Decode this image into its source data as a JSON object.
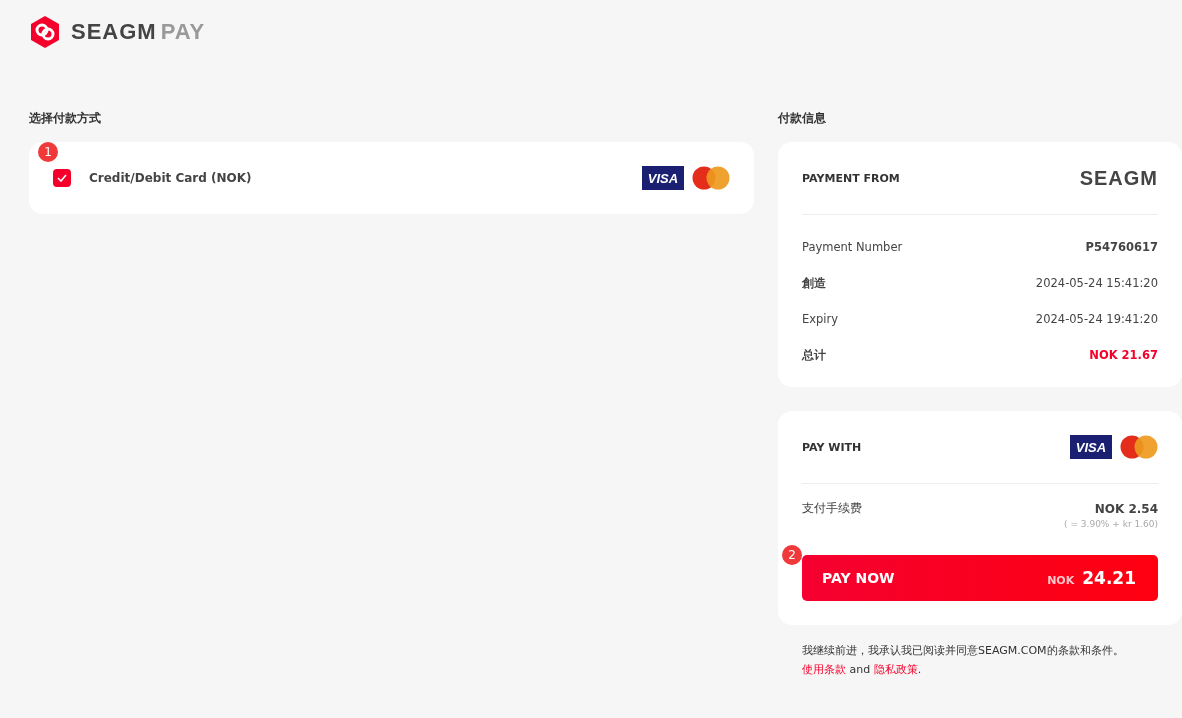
{
  "logo": {
    "brand": "SEAGM",
    "product": "PAY"
  },
  "methods": {
    "title": "选择付款方式",
    "items": [
      {
        "step": "1",
        "label": "Credit/Debit Card (NOK)",
        "checked": true,
        "card_mark": "VISA"
      }
    ]
  },
  "info": {
    "title": "付款信息",
    "header": "PAYMENT FROM",
    "brand": "SEAGM",
    "rows": [
      {
        "label": "Payment Number",
        "value": "P54760617",
        "kind": "strong",
        "label_bold": false
      },
      {
        "label": "創造",
        "value": "2024-05-24 15:41:20",
        "kind": "plain",
        "label_bold": true
      },
      {
        "label": "Expiry",
        "value": "2024-05-24 19:41:20",
        "kind": "plain",
        "label_bold": false
      },
      {
        "label": "总计",
        "value": "NOK 21.67",
        "kind": "total",
        "label_bold": true
      }
    ]
  },
  "pay": {
    "header": "PAY WITH",
    "card_mark": "VISA",
    "fee_label": "支付手续费",
    "fee_value": "NOK 2.54",
    "fee_note": "( = 3.90% + kr 1.60)",
    "step": "2",
    "button": "PAY NOW",
    "currency": "NOK",
    "amount": "24.21"
  },
  "agreement": {
    "text": "我继续前进，我承认我已阅读并同意SEAGM.COM的条款和条件。",
    "terms": "使用条款",
    "and": "and",
    "privacy": "隐私政策",
    "end": "."
  }
}
